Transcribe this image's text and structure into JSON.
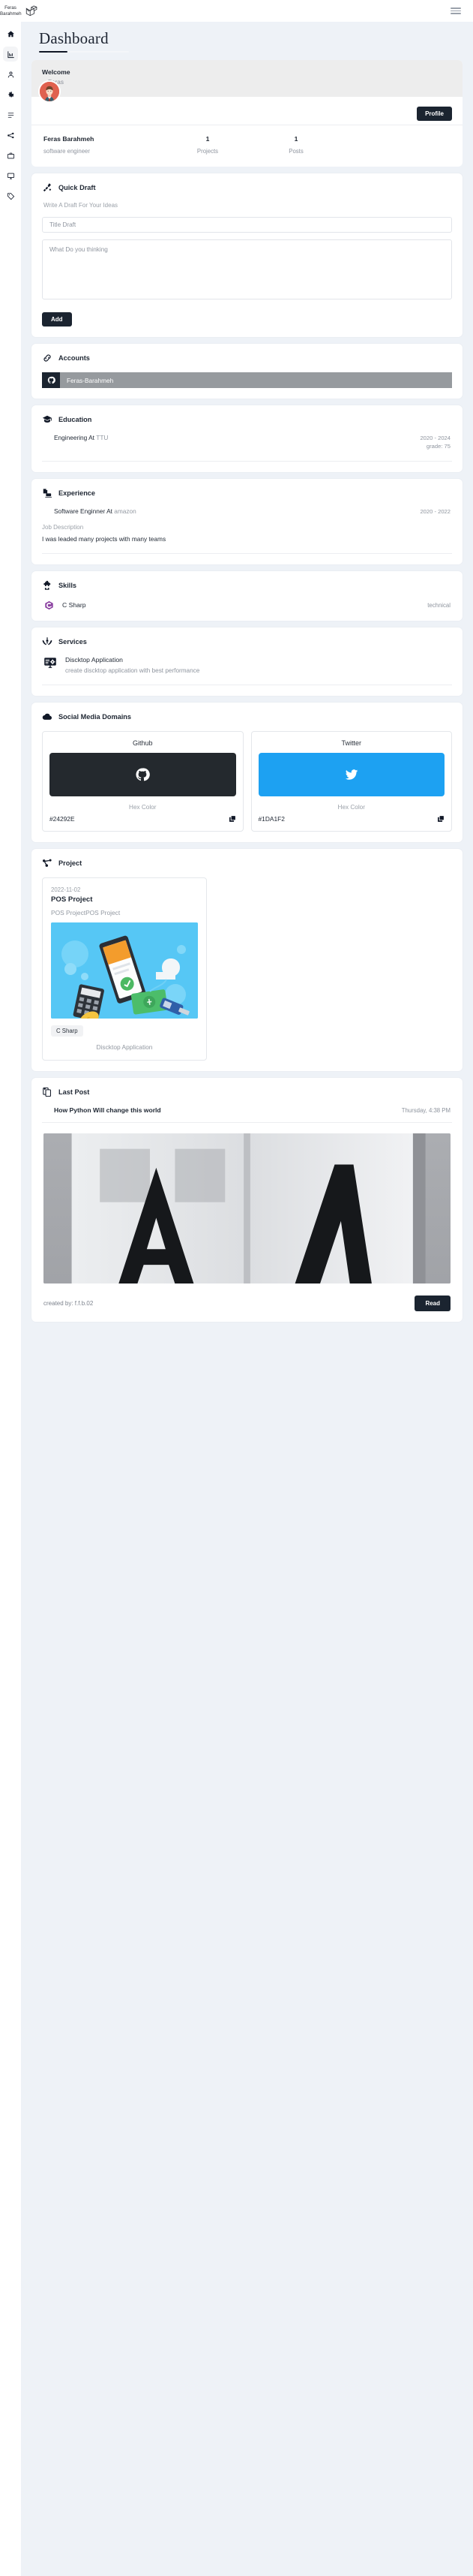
{
  "topbar": {
    "brand_name": "Feras Barahmeh",
    "logo_icon": "laravel-logo-icon",
    "menu_icon": "hamburger-menu-icon"
  },
  "sidebar": {
    "items": [
      {
        "icon": "home-icon",
        "name": "home",
        "active": false
      },
      {
        "icon": "dashboard-chart-icon",
        "name": "dashboard",
        "active": true
      },
      {
        "icon": "user-icon",
        "name": "profile",
        "active": false
      },
      {
        "icon": "gear-icon",
        "name": "settings",
        "active": false
      },
      {
        "icon": "list-icon",
        "name": "education",
        "active": false
      },
      {
        "icon": "share-nodes-icon",
        "name": "projects",
        "active": false
      },
      {
        "icon": "briefcase-icon",
        "name": "experience",
        "active": false
      },
      {
        "icon": "monitor-icon",
        "name": "services",
        "active": false
      },
      {
        "icon": "tag-icon",
        "name": "skills",
        "active": false
      }
    ]
  },
  "page": {
    "title": "Dashboard"
  },
  "welcome": {
    "title": "Welcome",
    "subtitle": "Feras",
    "profile_button": "Profile",
    "avatar_icon": "user-avatar",
    "stats": [
      {
        "value": "Feras Barahmeh",
        "label": "software engineer"
      },
      {
        "value": "1",
        "label": "Projects"
      },
      {
        "value": "1",
        "label": "Posts"
      }
    ]
  },
  "quick_draft": {
    "icon": "pen-ruler-icon",
    "title": "Quick Draft",
    "hint": "Write A Draft For Your Ideas",
    "title_placeholder": "Title Draft",
    "body_placeholder": "What Do you thinking",
    "add_button": "Add"
  },
  "accounts": {
    "icon": "link-icon",
    "title": "Accounts",
    "items": [
      {
        "icon": "github-icon",
        "name": "Feras-Barahmeh"
      }
    ]
  },
  "education": {
    "icon": "graduation-cap-icon",
    "title": "Education",
    "items": [
      {
        "degree": "Engineering At",
        "institution": "TTU",
        "years": "2020 - 2024",
        "grade": "grade: 75"
      }
    ]
  },
  "experience": {
    "icon": "laptop-file-icon",
    "title": "Experience",
    "items": [
      {
        "role": "Software Enginner At",
        "company": "amazon",
        "years": "2020 - 2022",
        "description_label": "Job Description",
        "description": "I was leaded many projects with many teams"
      }
    ]
  },
  "skills": {
    "icon": "puzzle-piece-icon",
    "title": "Skills",
    "items": [
      {
        "icon": "csharp-icon",
        "name": "C Sharp",
        "type": "technical",
        "color": "#8A3FA0"
      }
    ]
  },
  "services": {
    "icon": "hands-holding-icon",
    "title": "Services",
    "items": [
      {
        "icon": "monitor-gear-icon",
        "title": "Discktop Application",
        "description": "create discktop application with best performance"
      }
    ]
  },
  "social_media": {
    "icon": "cloud-icon",
    "title": "Social Media Domains",
    "hex_label": "Hex Color",
    "copy_icon": "copy-icon",
    "items": [
      {
        "name": "Github",
        "icon": "github-icon",
        "hex": "#24292E"
      },
      {
        "name": "Twitter",
        "icon": "twitter-icon",
        "hex": "#1DA1F2"
      }
    ]
  },
  "project": {
    "icon": "share-nodes-icon",
    "title": "Project",
    "items": [
      {
        "date": "2022-11-02",
        "name": "POS Project",
        "description": "POS ProjectPOS Project",
        "image": "pos-illustration",
        "tag": "C Sharp",
        "category": "Discktop Application"
      }
    ]
  },
  "last_post": {
    "icon": "clipboard-icon",
    "title": "Last Post",
    "post_title": "How Python Will change this world",
    "post_time": "Thursday, 4:38 PM",
    "post_image": "open-book-photo",
    "created_by": "created by: f.f.b.02",
    "read_button": "Read"
  }
}
